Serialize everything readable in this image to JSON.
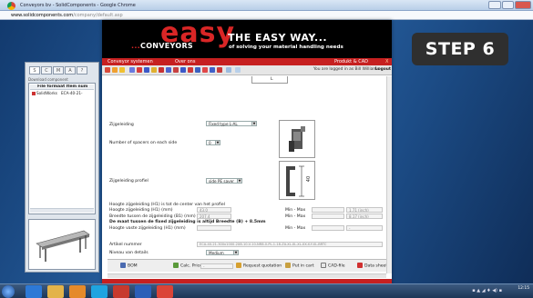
{
  "window": {
    "title": "Conveyors bv - SolidComponents - Google Chrome",
    "url_host": "www.solidcomponents.com",
    "url_path": "/company/default.asp"
  },
  "left_panel": {
    "tabs": [
      "S",
      "C",
      "M",
      "A",
      "?"
    ],
    "title": "Download component",
    "file_header": "File formaat  Item num",
    "file_row": {
      "name": "SolidWorks",
      "item": "ECA-40-21-"
    }
  },
  "banner": {
    "logo_top": "easy",
    "logo_bottom": "CONVEYORS",
    "logo_dots": "...",
    "tagline": "THE EASY WAY...",
    "subtagline": "of solving your material handling needs"
  },
  "menu": {
    "left": "Conveyor systemen",
    "middle": "Over ons",
    "right": "Produkt & CAD",
    "close": "X"
  },
  "toolbar": {
    "login_text": "You are logged in as Bill Williams",
    "logout": "Logout"
  },
  "form": {
    "image_top_label": "L",
    "zijgeleiding_label": "Zijgeleiding",
    "zijgeleiding_value": "Fixed type L-AL",
    "spacers_label": "Number of spacers on each side",
    "spacers_value": "0",
    "profiel_label": "Zijgeleiding profiel",
    "profiel_value": "side PE saver",
    "profile_dim": "40",
    "h1_center_label": "Hoogte zijgeleiding (H1) is tot de center van het profiel",
    "h1_label": "Hoogte zijgeleiding (H1) (mm)",
    "h1_value": "43.0",
    "b1_label": "Breedte tussen de zijgeleiding (B1) (mm)",
    "b1_value": "207.4",
    "note": "De maat tussen de fixed zijgeleiding is altijd Breedte (B) + 8.5mm",
    "h1_fixed_label": "Hoogte vaste zijgeleiding (H1) (mm)",
    "minmax_label": "Min - Max",
    "h1_range": "1.71 (inch)",
    "b1_range": "8.17 (inch)",
    "h1_fixed_range": "-",
    "article_label": "Artikel nummer",
    "article_value": "ECA-40-21-300x1000-2X8-10-V-10-NR8-0-PL-1-18-ZA-XL-XL-XL-XX-X-Y-XL-BRTC",
    "detail_label": "Niveau van details",
    "detail_value": "Medium"
  },
  "actions": {
    "bom": "BOM",
    "calc_price": "Calc. Price",
    "price_value": "-",
    "request_quotation": "Request quotation",
    "put_in_cart": "Put in cart",
    "cad_file": "CAD-file",
    "data_sheet": "Data sheet"
  },
  "step_badge": "STEP 6",
  "taskbar": {
    "clock_time": "12:15",
    "clock_date": ""
  },
  "colors": {
    "brand_red": "#c62020",
    "banner_black": "#000000",
    "desktop_blue": "#2a64a6",
    "badge": "#2f2f2f"
  },
  "icons": [
    "chrome-icon",
    "ie-icon",
    "explorer-icon",
    "media-icon",
    "skype-icon",
    "solidworks-icon",
    "word-icon",
    "chrome-taskbar-icon"
  ]
}
